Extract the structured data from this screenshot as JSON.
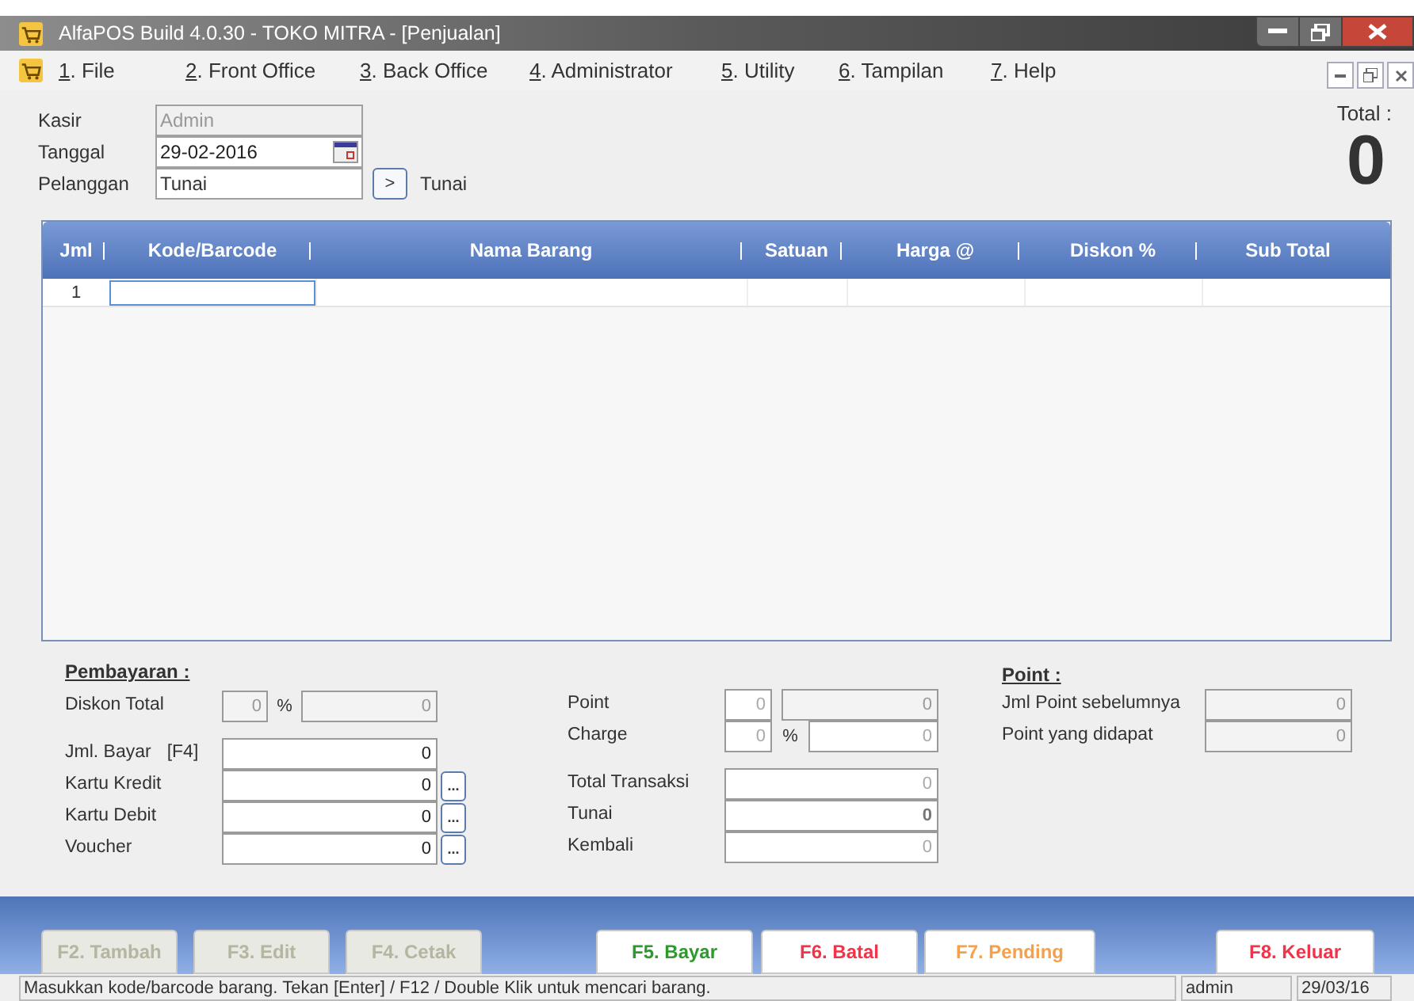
{
  "window": {
    "title": "AlfaPOS Build 4.0.30  - TOKO MITRA - [Penjualan]"
  },
  "menu": [
    {
      "key": "1",
      "label": ". File"
    },
    {
      "key": "2",
      "label": ". Front Office"
    },
    {
      "key": "3",
      "label": ". Back Office"
    },
    {
      "key": "4",
      "label": ". Administrator"
    },
    {
      "key": "5",
      "label": ". Utility"
    },
    {
      "key": "6",
      "label": ". Tampilan"
    },
    {
      "key": "7",
      "label": ". Help"
    }
  ],
  "header": {
    "kasir": {
      "label": "Kasir",
      "value": "Admin",
      "disabled": true
    },
    "tanggal": {
      "label": "Tanggal",
      "value": "29-02-2016"
    },
    "pelanggan": {
      "label": "Pelanggan",
      "value": "Tunai",
      "button": ">",
      "name": "Tunai"
    }
  },
  "total": {
    "label": "Total :",
    "value": "0"
  },
  "table": {
    "columns": [
      "Jml",
      "Kode/Barcode",
      "Nama Barang",
      "Satuan",
      "Harga @",
      "Diskon %",
      "Sub Total"
    ],
    "rows": [
      {
        "jml": "1"
      }
    ]
  },
  "payment": {
    "title": "Pembayaran :",
    "diskon_total": {
      "label": "Diskon Total",
      "percent": "0",
      "percent_sign": "%",
      "amount": "0"
    },
    "rows": [
      {
        "label": "Jml. Bayar",
        "hotkey": "[F4]",
        "value": "0"
      },
      {
        "label": "Kartu Kredit",
        "value": "0",
        "button": "..."
      },
      {
        "label": "Kartu Debit",
        "value": "0",
        "button": "..."
      },
      {
        "label": "Voucher",
        "value": "0",
        "button": "..."
      }
    ]
  },
  "summary": {
    "point": {
      "label": "Point",
      "count": "0",
      "amount": "0"
    },
    "charge": {
      "label": "Charge",
      "percent": "0",
      "percent_sign": "%",
      "amount": "0"
    },
    "totals": [
      {
        "label": "Total Transaksi",
        "value": "0",
        "bold": false
      },
      {
        "label": "Tunai",
        "value": "0",
        "bold": true
      },
      {
        "label": "Kembali",
        "value": "0",
        "bold": false
      }
    ]
  },
  "points": {
    "title": "Point :",
    "rows": [
      {
        "label": "Jml Point sebelumnya",
        "value": "0"
      },
      {
        "label": "Point yang didapat",
        "value": "0"
      }
    ]
  },
  "buttons": [
    {
      "label": "F2. Tambah",
      "disabled": true,
      "color": "#b5b5a0"
    },
    {
      "label": "F3. Edit",
      "disabled": true,
      "color": "#b5b5a0"
    },
    {
      "label": "F4. Cetak",
      "disabled": true,
      "color": "#b5b5a0"
    },
    {
      "label": "F5. Bayar",
      "disabled": false,
      "color": "#2e9a2e"
    },
    {
      "label": "F6. Batal",
      "disabled": false,
      "color": "#f0344a"
    },
    {
      "label": "F7. Pending",
      "disabled": false,
      "color": "#f7a04a"
    },
    {
      "label": "F8. Keluar",
      "disabled": false,
      "color": "#f0344a"
    }
  ],
  "status_bar": {
    "message": "Masukkan kode/barcode barang. Tekan [Enter] / F12 / Double Klik untuk mencari barang.",
    "user": "admin",
    "date": "29/03/16"
  }
}
